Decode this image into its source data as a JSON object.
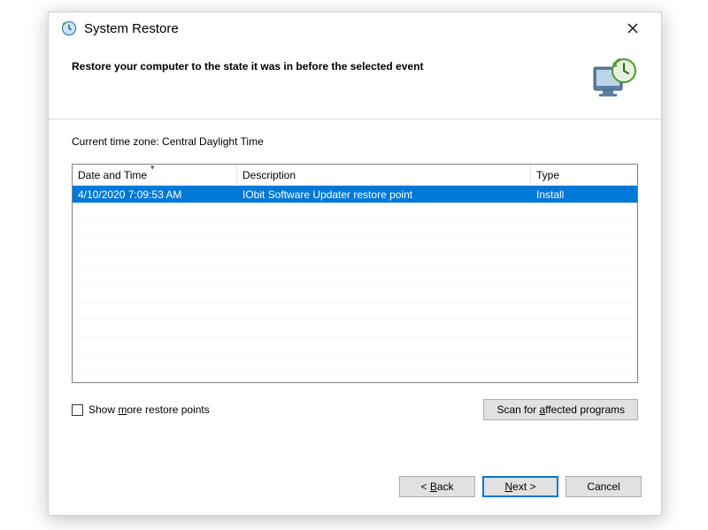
{
  "title": "System Restore",
  "header_text": "Restore your computer to the state it was in before the selected event",
  "timezone_label": "Current time zone: Central Daylight Time",
  "columns": {
    "datetime": "Date and Time",
    "description": "Description",
    "type": "Type"
  },
  "rows": [
    {
      "datetime": "4/10/2020 7:09:53 AM",
      "description": "IObit Software Updater restore point",
      "type": "Install",
      "selected": true
    }
  ],
  "show_more_label_pre": "Show ",
  "show_more_label_u": "m",
  "show_more_label_post": "ore restore points",
  "scan_label_pre": "Scan for ",
  "scan_label_u": "a",
  "scan_label_post": "ffected programs",
  "back_u": "B",
  "back_post": "ack",
  "back_pre": "< ",
  "next_u": "N",
  "next_post": "ext >",
  "cancel_label": "Cancel"
}
